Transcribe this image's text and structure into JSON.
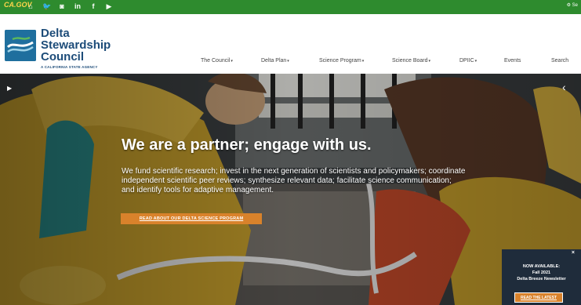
{
  "topbar": {
    "ca_logo": "CA.GOV",
    "social": [
      {
        "icon": "home-icon",
        "glyph": "⌂"
      },
      {
        "icon": "twitter-icon",
        "glyph": "🐦"
      },
      {
        "icon": "instagram-icon",
        "glyph": "◙"
      },
      {
        "icon": "linkedin-icon",
        "glyph": "in"
      },
      {
        "icon": "facebook-icon",
        "glyph": "f"
      },
      {
        "icon": "youtube-icon",
        "glyph": "▶"
      }
    ],
    "settings_label": "⚙ Se"
  },
  "logo": {
    "name_lines": [
      "Delta",
      "Stewardship",
      "Council"
    ],
    "subtitle": "A CALIFORNIA STATE AGENCY"
  },
  "nav": [
    {
      "label": "The Council",
      "caret": "▾"
    },
    {
      "label": "Delta Plan",
      "caret": "▾"
    },
    {
      "label": "Science Program",
      "caret": "▾"
    },
    {
      "label": "Science Board",
      "caret": "▾"
    },
    {
      "label": "DPIIC",
      "caret": "▾"
    },
    {
      "label": "Events",
      "caret": ""
    },
    {
      "label": "Search",
      "caret": ""
    }
  ],
  "hero": {
    "play_glyph": "▶",
    "prev_glyph": "‹",
    "headline": "We are a partner; engage with us.",
    "body": "We fund scientific research; invest in the next generation of scientists and policymakers; coordinate independent scientific peer reviews; synthesize relevant data; facilitate science communication; and identify tools for adaptive management.",
    "cta_label": "READ ABOUT OUR DELTA SCIENCE PROGRAM"
  },
  "popup": {
    "close_glyph": "×",
    "line1": "NOW AVAILABLE:",
    "line2": "Fall 2021",
    "line3": "Delta Breeze Newsletter",
    "button_label": "READ THE LATEST"
  },
  "colors": {
    "topbar": "#2e8b2e",
    "brand": "#1d4c79",
    "accent": "#d9822b"
  }
}
